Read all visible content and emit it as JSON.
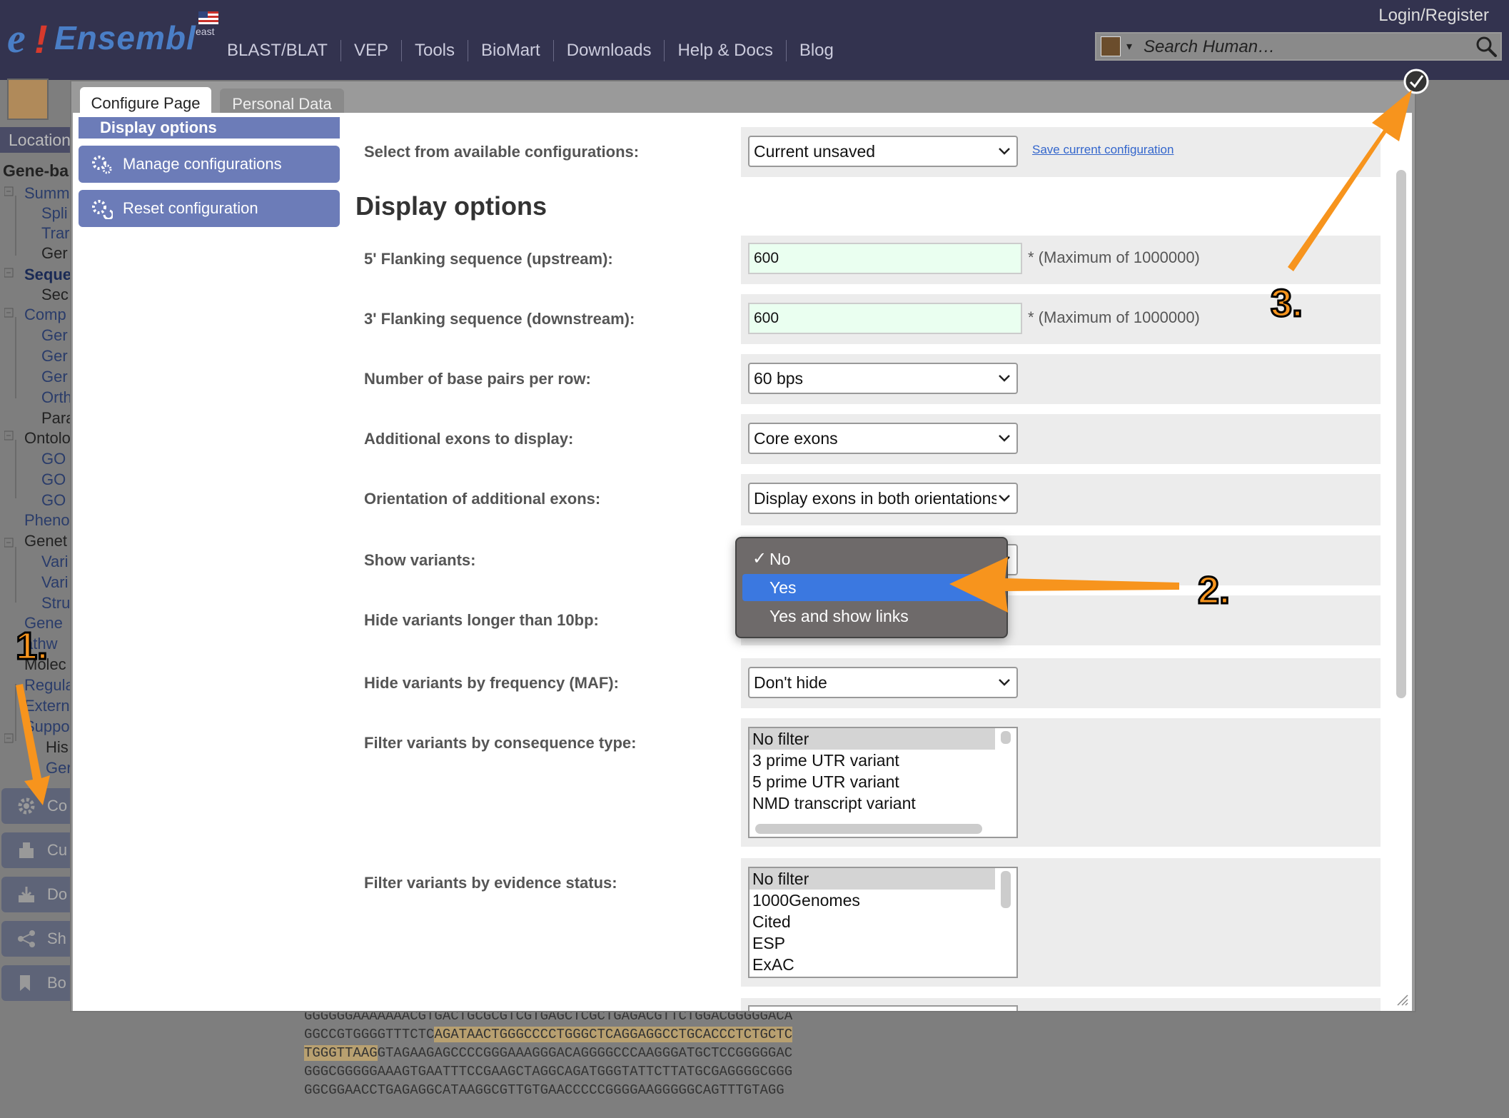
{
  "header": {
    "logo_text": "e!Ensembl",
    "flag_label": "east",
    "nav": [
      "BLAST/BLAT",
      "VEP",
      "Tools",
      "BioMart",
      "Downloads",
      "Help & Docs",
      "Blog"
    ],
    "login_label": "Login/Register",
    "search_placeholder": "Search Human…"
  },
  "underlying_page": {
    "location_tab": "Location",
    "sidebar_title": "Gene-ba",
    "tree_items": [
      "Summ",
      "Spli",
      "Trar",
      "Ger",
      "Seque",
      "Sec",
      "Comp",
      "Ger",
      "Ger",
      "Ger",
      "Orth",
      "Para",
      "Ontolo",
      "GO",
      "GO",
      "GO",
      "Pheno",
      "Genet",
      "Vari",
      "Vari",
      "Stru",
      "Gene",
      "athw",
      "Molec",
      "Regula",
      "Extern",
      "Suppo",
      "His",
      "Ger"
    ],
    "side_buttons": [
      "Co",
      "Cu",
      "Do",
      "Sh",
      "Bo"
    ],
    "sequence_lines": [
      "GGGGGGAAAAAAACGTGACTGCGCGTCGTGAGCTCGCTGAGACGTTCTGGACGGGGGACA",
      "GGCCGTGGGGTTTCTCAGATAACTGGGCCCCTGGGCTCAGGAGGCCTGCACCCTCTGCTC",
      "TGGGTTAAGGTAGAAGAGCCCCGGGAAAGGGACAGGGGCCCAAGGGATGCTCCGGGGGAC",
      "GGGCGGGGGAAAGTGAATTTCCGAAGCTAGGCAGATGGGTATTCTTATGCGAGGGGCGGG",
      "GGCGGAACCTGAGAGGCATAAGGCGTTGTGAACCCCCGGGGAAGGGGGCAGTTTGTAGG"
    ]
  },
  "modal": {
    "tabs": [
      "Configure Page",
      "Personal Data"
    ],
    "left_heading": "Display options",
    "left_buttons": [
      "Manage configurations",
      "Reset configuration"
    ],
    "config_label": "Select from available configurations:",
    "config_value": "Current unsaved",
    "save_link": "Save current configuration",
    "section_title": "Display options",
    "fields": {
      "flank5": {
        "label": "5' Flanking sequence (upstream):",
        "value": "600",
        "note": "* (Maximum of 1000000)"
      },
      "flank3": {
        "label": "3' Flanking sequence (downstream):",
        "value": "600",
        "note": "* (Maximum of 1000000)"
      },
      "bp_per_row": {
        "label": "Number of base pairs per row:",
        "value": "60 bps"
      },
      "exons": {
        "label": "Additional exons to display:",
        "value": "Core exons"
      },
      "orientation": {
        "label": "Orientation of additional exons:",
        "value": "Display exons in both orientations"
      },
      "show_variants": {
        "label": "Show variants:",
        "value": "No"
      },
      "hide_long": {
        "label": "Hide variants longer than 10bp:"
      },
      "hide_maf": {
        "label": "Hide variants by frequency (MAF):",
        "value": "Don't hide"
      },
      "consequence": {
        "label": "Filter variants by consequence type:",
        "options": [
          "No filter",
          "3 prime UTR variant",
          "5 prime UTR variant",
          "NMD transcript variant"
        ]
      },
      "evidence": {
        "label": "Filter variants by evidence status:",
        "options": [
          "No filter",
          "1000Genomes",
          "Cited",
          "ESP",
          "ExAC"
        ]
      }
    },
    "variants_popup": {
      "options": [
        "No",
        "Yes",
        "Yes and show links"
      ],
      "checked": "No",
      "highlighted": "Yes"
    }
  },
  "annotations": {
    "step1": "1.",
    "step2": "2.",
    "step3": "3.",
    "arrow_color": "#f7941d"
  }
}
